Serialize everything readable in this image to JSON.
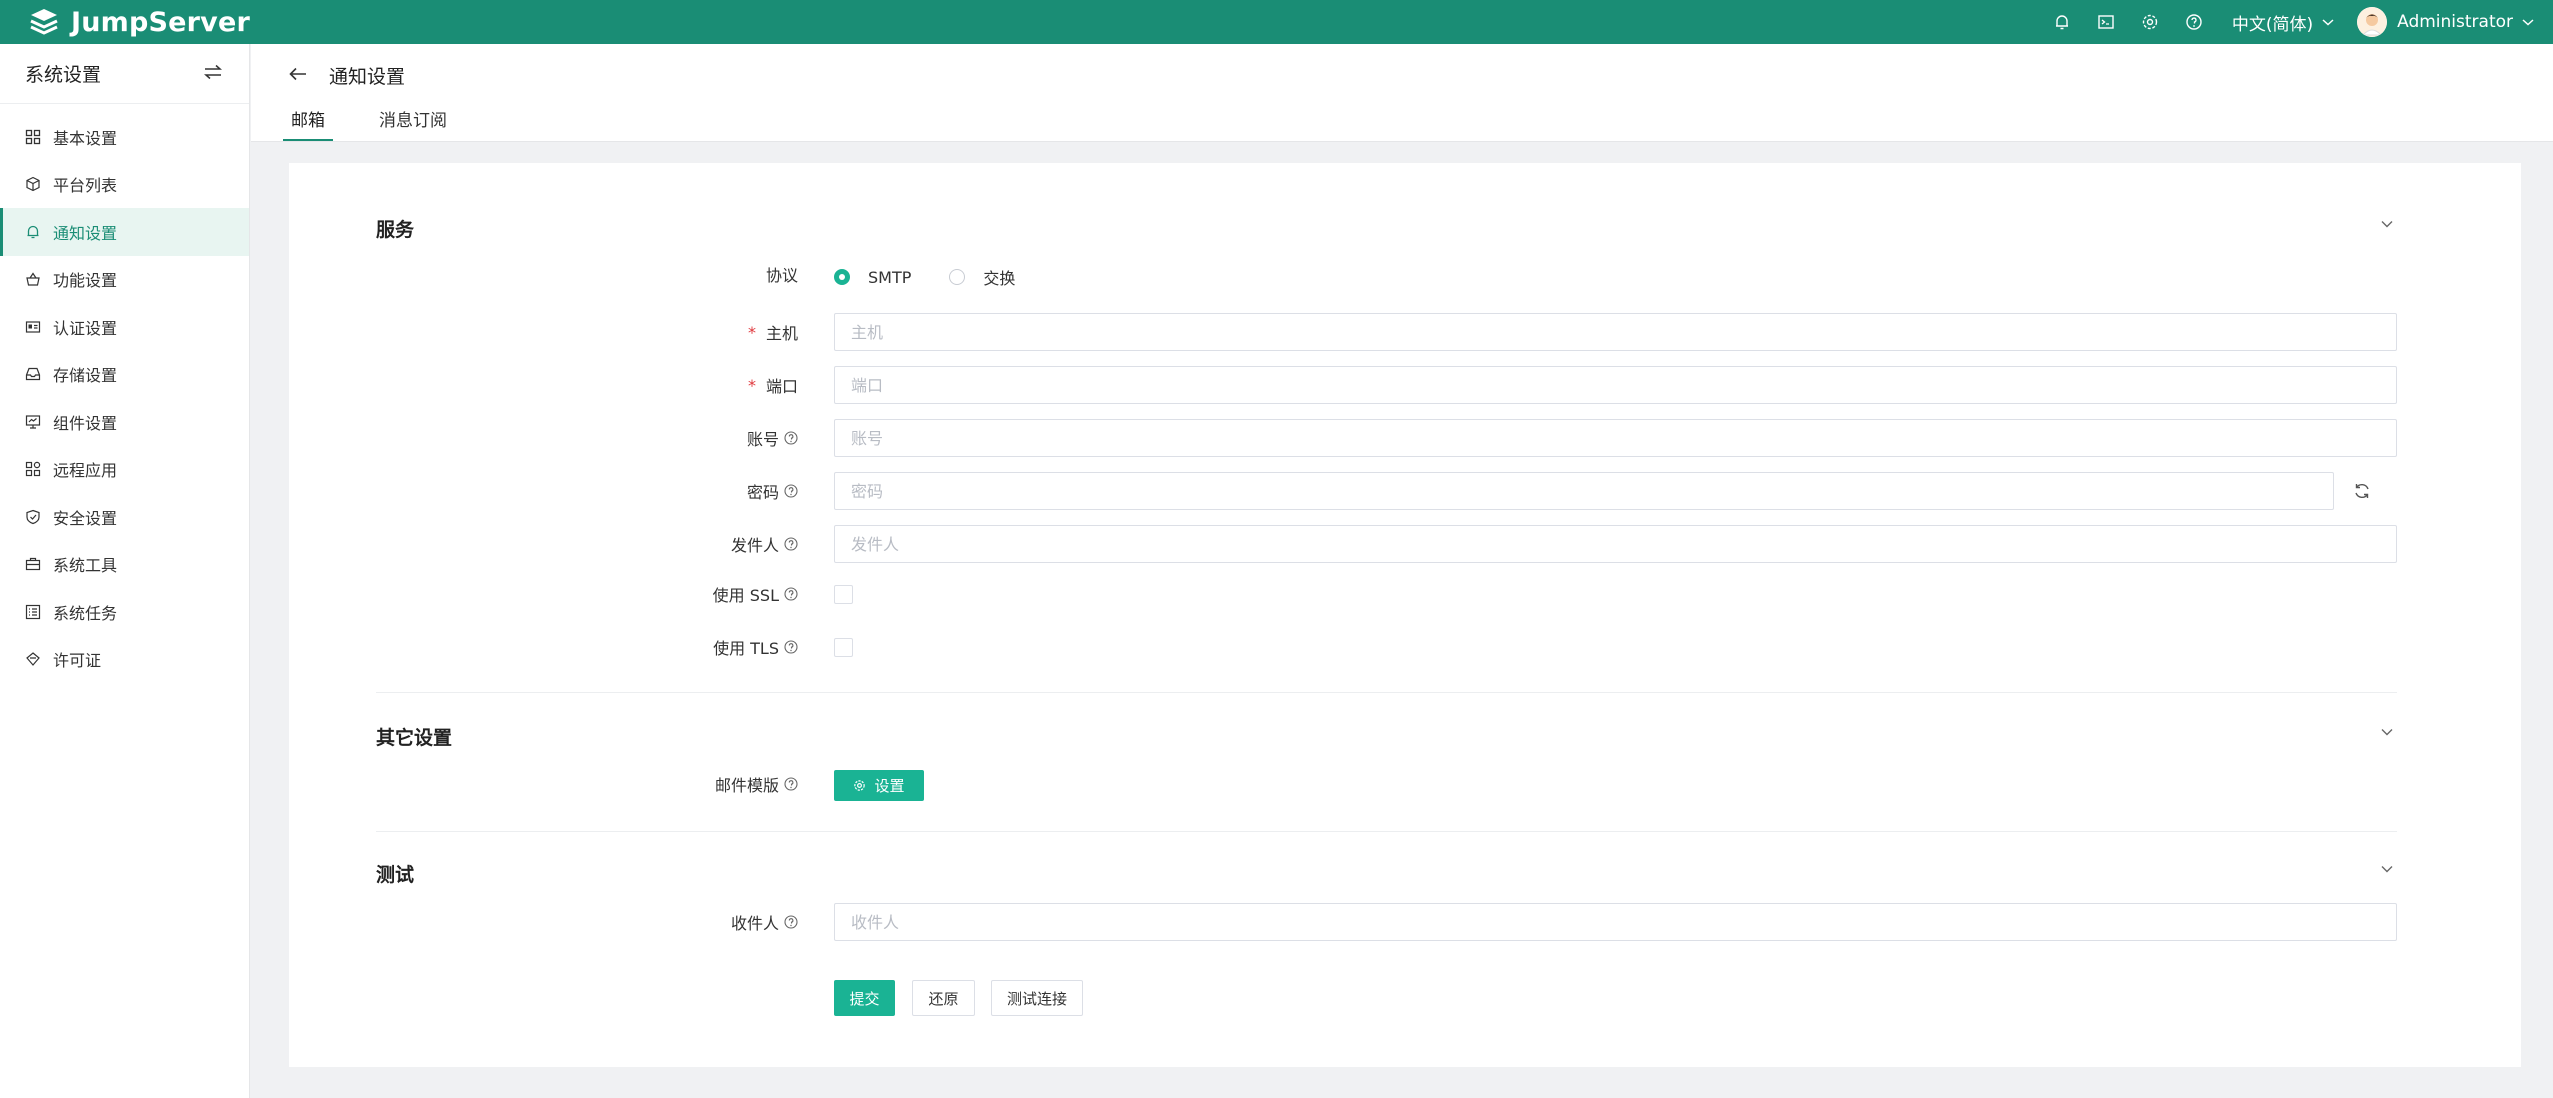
{
  "app": {
    "brand": "JumpServer"
  },
  "topbar": {
    "icons": [
      "bell-icon",
      "terminal-icon",
      "settings-icon",
      "help-icon"
    ],
    "language": "中文(简体)",
    "user": "Administrator"
  },
  "sidebar": {
    "title": "系统设置",
    "items": [
      {
        "label": "基本设置",
        "icon": "grid-icon"
      },
      {
        "label": "平台列表",
        "icon": "cube-icon"
      },
      {
        "label": "通知设置",
        "icon": "bell-icon",
        "active": true
      },
      {
        "label": "功能设置",
        "icon": "basket-icon"
      },
      {
        "label": "认证设置",
        "icon": "id-card-icon"
      },
      {
        "label": "存储设置",
        "icon": "inbox-icon"
      },
      {
        "label": "组件设置",
        "icon": "monitor-icon"
      },
      {
        "label": "远程应用",
        "icon": "apps-icon"
      },
      {
        "label": "安全设置",
        "icon": "shield-icon"
      },
      {
        "label": "系统工具",
        "icon": "toolbox-icon"
      },
      {
        "label": "系统任务",
        "icon": "list-icon"
      },
      {
        "label": "许可证",
        "icon": "license-icon"
      }
    ]
  },
  "page": {
    "title": "通知设置",
    "tabs": [
      {
        "label": "邮箱",
        "active": true
      },
      {
        "label": "消息订阅",
        "active": false
      }
    ]
  },
  "form": {
    "service": {
      "title": "服务",
      "protocol_label": "协议",
      "protocol_options": [
        {
          "label": "SMTP",
          "checked": true
        },
        {
          "label": "交换",
          "checked": false
        }
      ],
      "host_label": "主机",
      "host_placeholder": "主机",
      "port_label": "端口",
      "port_placeholder": "端口",
      "account_label": "账号",
      "account_placeholder": "账号",
      "password_label": "密码",
      "password_placeholder": "密码",
      "sender_label": "发件人",
      "sender_placeholder": "发件人",
      "ssl_label": "使用 SSL",
      "ssl_checked": false,
      "tls_label": "使用 TLS",
      "tls_checked": false
    },
    "other": {
      "title": "其它设置",
      "template_label": "邮件模版",
      "settings_button": "设置"
    },
    "test": {
      "title": "测试",
      "recipient_label": "收件人",
      "recipient_placeholder": "收件人"
    },
    "actions": {
      "submit": "提交",
      "reset": "还原",
      "test_connection": "测试连接"
    }
  },
  "colors": {
    "primary": "#1ab394",
    "topbar": "#1a8d75",
    "required": "#e0393e"
  }
}
